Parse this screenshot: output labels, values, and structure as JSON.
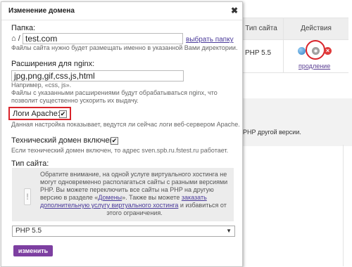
{
  "background": {
    "col_type_header": "Тип сайта",
    "col_actions_header": "Действия",
    "php_value": "PHP 5.5",
    "prod_link": "продление",
    "other_text": "PHP другой версии."
  },
  "modal": {
    "title": "Изменение домена",
    "close_icon": "close-icon",
    "folder": {
      "label": "Папка:",
      "prefix": "⌂ /",
      "value": "test.com",
      "link": "выбрать папку",
      "hint": "Файлы сайта нужно будет размещать именно в указанной Вами директории."
    },
    "nginx": {
      "label": "Расширения для nginx:",
      "value": "jpg,png,gif,css,js,html",
      "hint_example": "Например, «css, js».",
      "hint_1": "Файлы с указанными расширениями будут обрабатываться nginx, что",
      "hint_2": "позволит существенно ускорить их выдачу."
    },
    "apache_logs": {
      "label": "Логи Apache:",
      "checked": true,
      "hint": "Данная настройка показывает, ведутся ли сейчас логи веб-сервером Apache."
    },
    "tech_domain": {
      "label": "Технический домен включен:",
      "checked": true,
      "hint": "Если технический домен включен, то адрес sven.spb.ru.fstest.ru работает."
    },
    "site_type": {
      "label": "Тип сайта:",
      "notice_1": "Обратите внимание, на одной услуге виртуального хостинга не",
      "notice_2": "могут одновременно располагаться сайты с разными версиями",
      "notice_3": "PHP. Вы можете переключить все сайты на PHP на другую",
      "notice_4a": "версию в разделе «",
      "notice_4_link": "Домены",
      "notice_4b": "». Также вы можете",
      "notice_4_link2": "заказать",
      "notice_5_link": "дополнительную услугу виртуального хостинга",
      "notice_5b": " и избавиться от",
      "notice_6": "этого ограничения.",
      "select_value": "PHP 5.5"
    },
    "submit_label": "изменить"
  },
  "colors": {
    "accent": "#7d3fa1",
    "highlight": "#d8232a",
    "link": "#4a3a9a"
  }
}
